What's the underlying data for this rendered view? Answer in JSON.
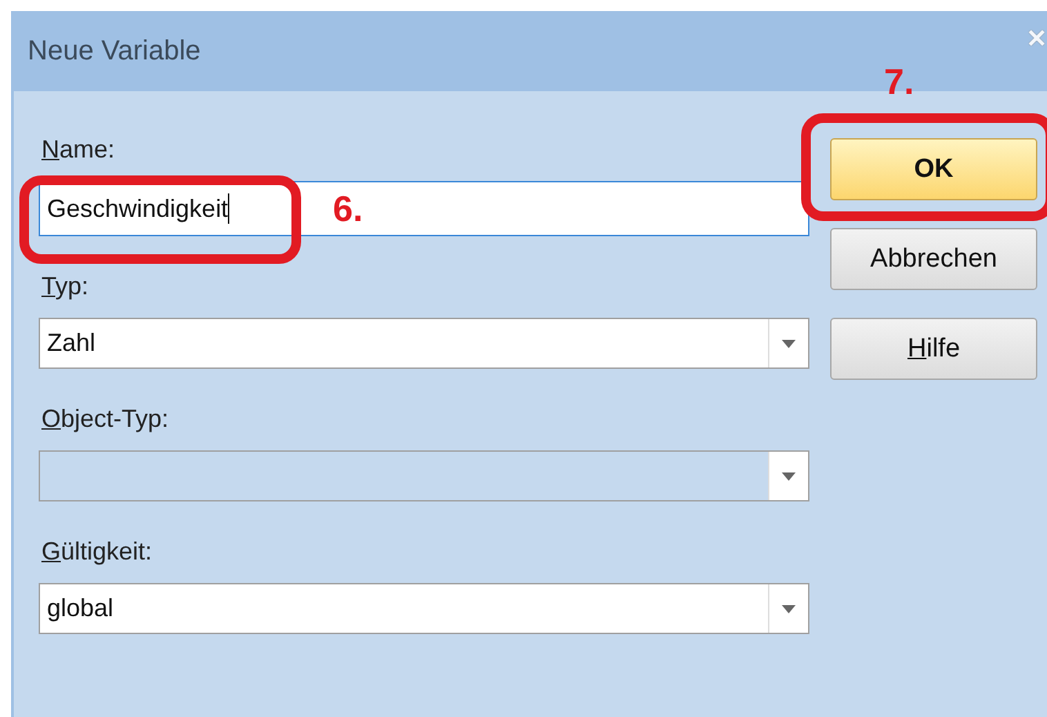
{
  "window": {
    "title": "Neue Variable",
    "close": "✕"
  },
  "fields": [
    {
      "kind": "text",
      "label": "Name:",
      "value": "Geschwindigkeit",
      "focused": true,
      "disabled": false
    },
    {
      "kind": "combo",
      "label": "Typ:",
      "value": "Zahl",
      "disabled": false
    },
    {
      "kind": "combo",
      "label": "Object-Typ:",
      "disabled": true
    },
    {
      "kind": "combo",
      "label": "Gültigkeit:",
      "value": "global",
      "disabled": false
    }
  ],
  "buttons": [
    {
      "label": "OK",
      "default": true
    },
    {
      "label": "Abbrechen",
      "default": false
    },
    {
      "label": "Hilfe",
      "default": false
    }
  ],
  "annotations": [
    {
      "label": "6.",
      "kind": "field"
    },
    {
      "label": "7.",
      "kind": "button"
    }
  ]
}
